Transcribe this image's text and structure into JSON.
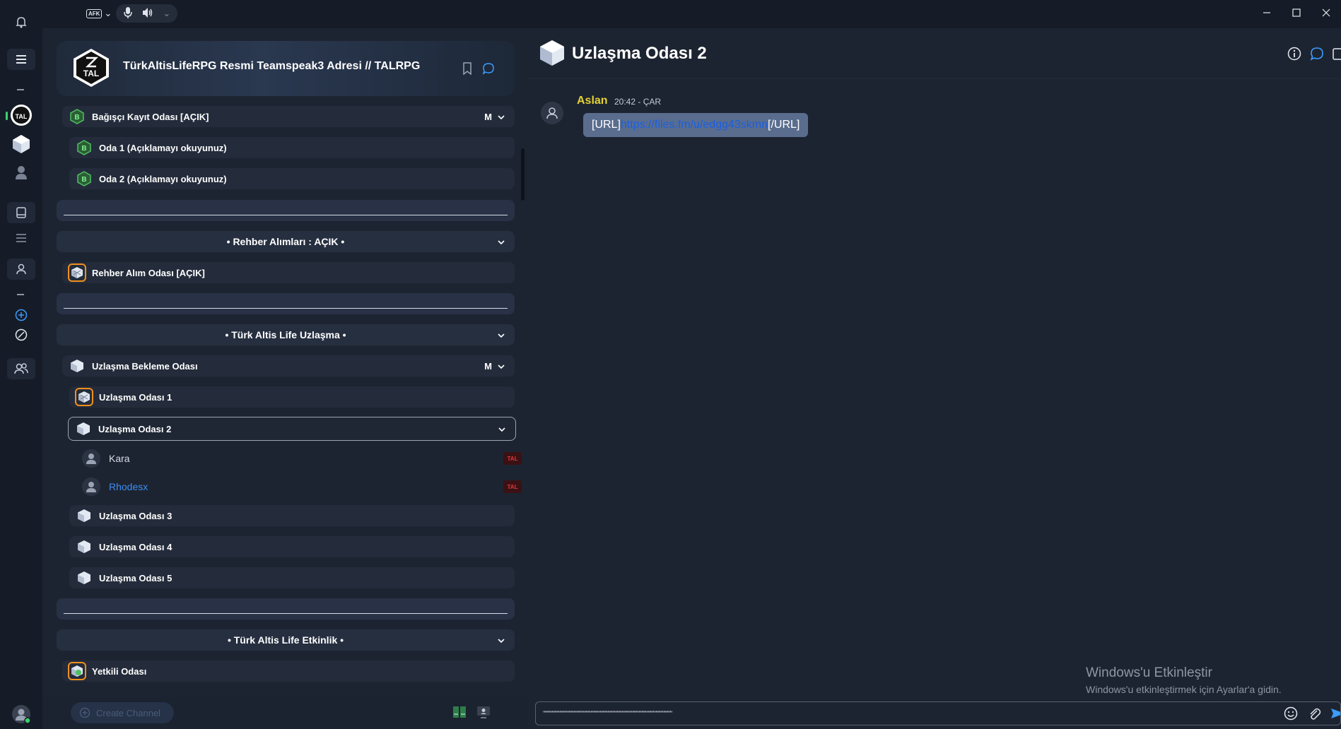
{
  "toolbar": {
    "afk_label": "AFK",
    "chevron": "⌄"
  },
  "server": {
    "title": "TürkAltisLifeRPG Resmi Teamspeak3 Adresi // TALRPG",
    "logo_text": "TAL"
  },
  "channels": {
    "bagisci": {
      "label": "Bağışçı Kayıt Odası [AÇIK]",
      "mod": "M"
    },
    "oda1": {
      "label": "Oda 1 (Açıklamayı okuyunuz)"
    },
    "oda2": {
      "label": "Oda 2 (Açıklamayı okuyunuz)"
    },
    "rehber_header": {
      "label": "• Rehber Alımları : AÇIK •"
    },
    "rehber_oda": {
      "label": "Rehber Alım Odası [AÇIK]"
    },
    "uzlasma_header": {
      "label": "• Türk Altis Life Uzlaşma •"
    },
    "uzlasma_bekleme": {
      "label": "Uzlaşma Bekleme Odası",
      "mod": "M"
    },
    "uzlasma1": {
      "label": "Uzlaşma Odası 1"
    },
    "uzlasma2": {
      "label": "Uzlaşma Odası 2"
    },
    "users": [
      {
        "name": "Kara",
        "color": "#d7dde6",
        "badge": "TAL"
      },
      {
        "name": "Rhodesx",
        "color": "#3d8cf0",
        "badge": "TAL"
      }
    ],
    "uzlasma3": {
      "label": "Uzlaşma Odası 3"
    },
    "uzlasma4": {
      "label": "Uzlaşma Odası 4"
    },
    "uzlasma5": {
      "label": "Uzlaşma Odası 5"
    },
    "etkinlik_header": {
      "label": "• Türk Altis Life Etkinlik •"
    },
    "yetkili": {
      "label": "Yetkili Odası"
    }
  },
  "panel_footer": {
    "create_channel": "Create Channel"
  },
  "chat": {
    "title": "Uzlaşma Odası 2",
    "message": {
      "author": "Aslan",
      "time": "20:42 - ÇAR",
      "prefix": "[URL]",
      "link": "https://files.fm/u/edgg43skmn",
      "suffix": "[/URL]"
    },
    "input_value": "\"\"\"\"\"\"\"\"\"\"\"\"\"\"\"\"\"\"\"\"\"\"\"\"\"\"\"\"\"\"\"\"\"\"\"\"\"\"\"\"\"\"\"\"\"\"\"\"\"\"\"\"\"\"\"\"\"\"\"\"\"\"\"\"\"\"\"\"\"\"\"\"\"\"\"\"\"\"\"\"\"\"\""
  },
  "watermark": {
    "title": "Windows'u Etkinleştir",
    "subtitle": "Windows'u etkinleştirmek için Ayarlar'a gidin."
  },
  "colors": {
    "accent_blue": "#3b9cff",
    "author_yellow": "#e4d234",
    "orange_frame": "#f0901d",
    "link_blue": "#1b5fe0"
  }
}
